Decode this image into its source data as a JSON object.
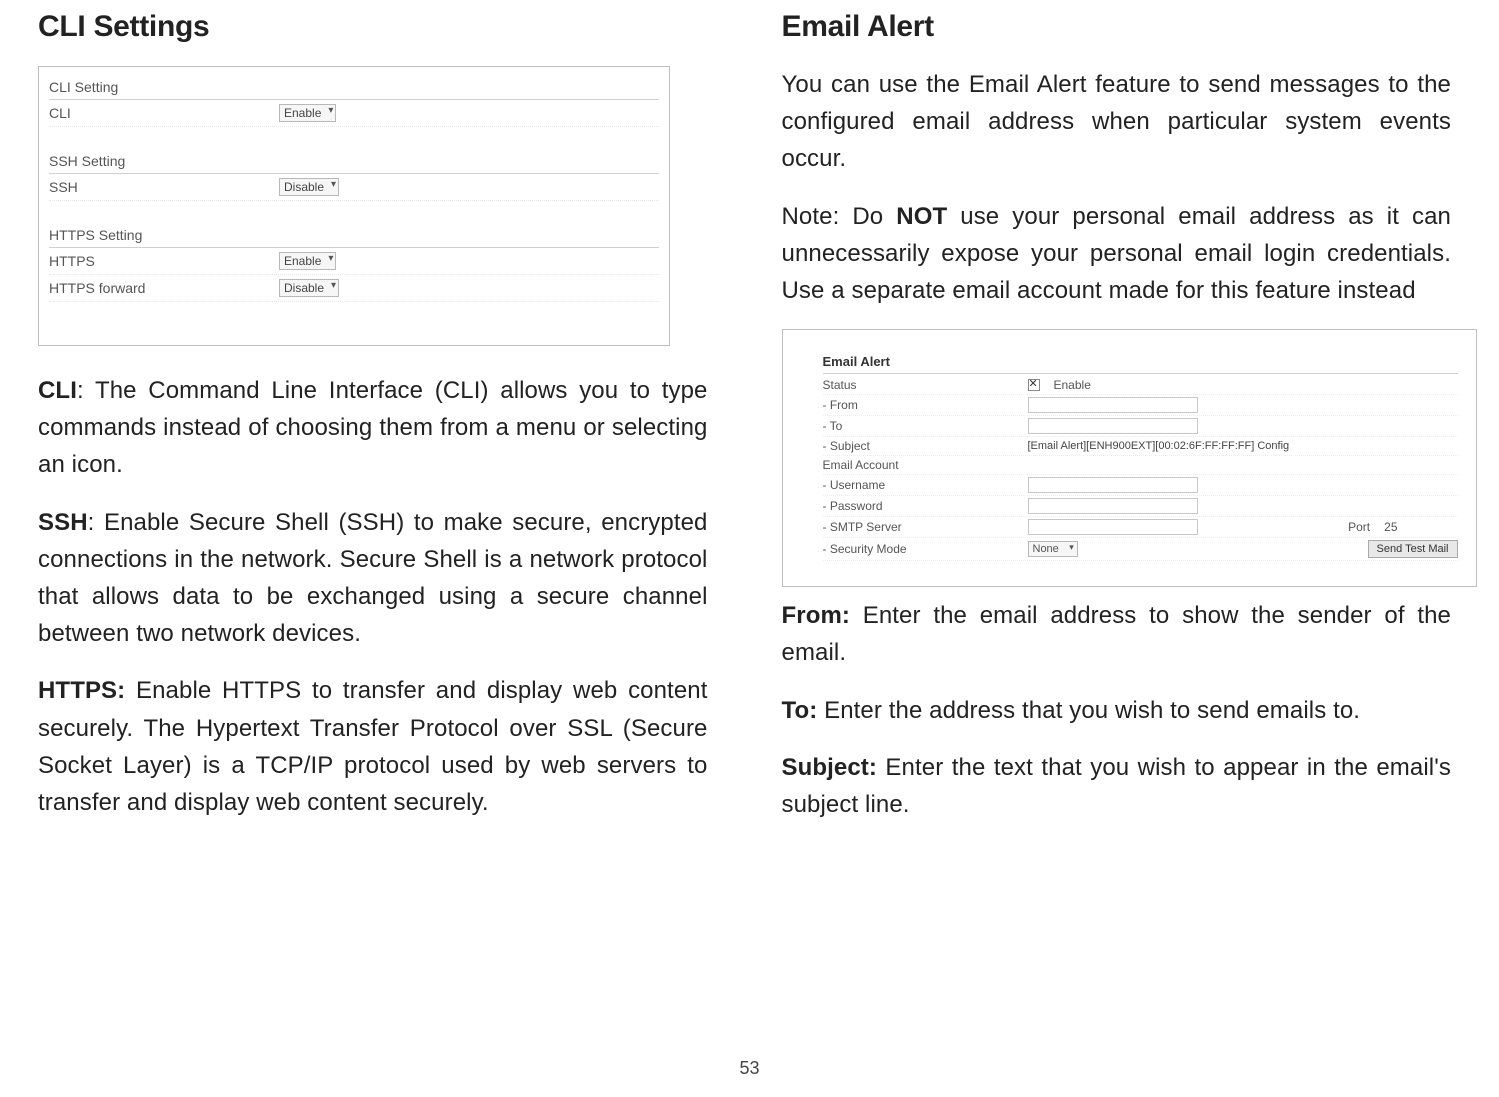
{
  "page_number": "53",
  "left": {
    "heading": "CLI Settings",
    "screenshot": {
      "sec1_title": "CLI Setting",
      "row1_label": "CLI",
      "row1_value": "Enable",
      "sec2_title": "SSH Setting",
      "row2_label": "SSH",
      "row2_value": "Disable",
      "sec3_title": "HTTPS Setting",
      "row3_label": "HTTPS",
      "row3_value": "Enable",
      "row4_label": "HTTPS forward",
      "row4_value": "Disable"
    },
    "p1_bold": "CLI",
    "p1_rest": ": The Command Line Interface (CLI) allows you to type commands instead of choosing them from a menu or selecting an icon.",
    "p2_bold": "SSH",
    "p2_rest": ": Enable Secure Shell (SSH) to make secure, encrypted connections in the network. Secure Shell is a network protocol that allows data to be exchanged using a secure channel between two network devices.",
    "p3_bold": "HTTPS:",
    "p3_rest": " Enable HTTPS to transfer and display web content securely. The Hypertext Transfer Protocol over SSL (Secure Socket Layer) is a TCP/IP protocol used by web servers to transfer and display web content securely."
  },
  "right": {
    "heading": "Email Alert",
    "p1": "You can use the Email Alert feature to send messages to the configured email address when particular system events occur.",
    "note_pre": " Note: Do ",
    "note_bold": "NOT",
    "note_post": " use your personal email address as it can unnecessarily expose your personal email login credentials. Use a separate email account made for this feature instead",
    "screenshot": {
      "title": "Email Alert",
      "status_label": "Status",
      "status_value": "Enable",
      "from_label": "From",
      "to_label": "To",
      "subject_label": "Subject",
      "subject_value": "[Email Alert][ENH900EXT][00:02:6F:FF:FF:FF] Config",
      "account_label": "Email Account",
      "username_label": "Username",
      "password_label": "Password",
      "smtp_label": "SMTP Server",
      "port_label": "Port",
      "port_value": "25",
      "security_label": "Security Mode",
      "security_value": "None",
      "send_button": "Send Test Mail"
    },
    "p2_bold": "From:",
    "p2_rest": " Enter the email address to show the sender of the email.",
    "p3_bold": "To:",
    "p3_rest": " Enter the address that you wish to send emails to.",
    "p4_bold": "Subject:",
    "p4_rest": " Enter the text that you wish to appear in the email's subject line."
  }
}
